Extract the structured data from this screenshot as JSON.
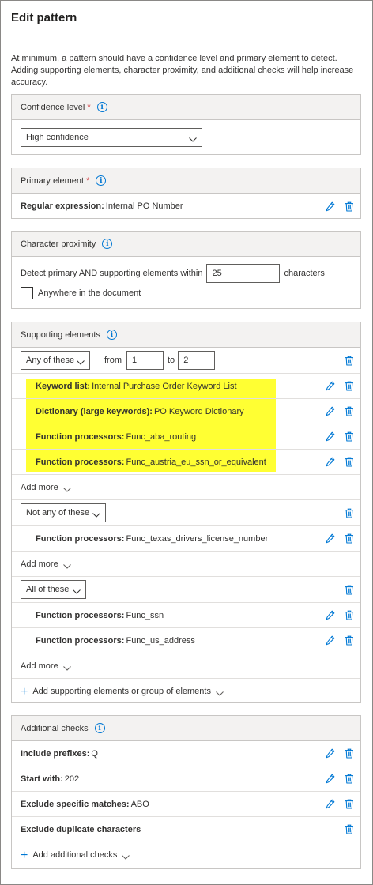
{
  "title": "Edit pattern",
  "intro": "At minimum, a pattern should have a confidence level and primary element to detect. Adding supporting elements, character proximity, and additional checks will help increase accuracy.",
  "confidence": {
    "heading": "Confidence level",
    "required": "*",
    "info": "i",
    "selected": "High confidence"
  },
  "primary": {
    "heading": "Primary element",
    "required": "*",
    "info": "i",
    "label": "Regular expression:",
    "value": "Internal PO Number"
  },
  "proximity": {
    "heading": "Character proximity",
    "info": "i",
    "prefix": "Detect primary AND supporting elements within",
    "value": "25",
    "suffix": "characters",
    "anywhere_label": "Anywhere in the document"
  },
  "supporting": {
    "heading": "Supporting elements",
    "info": "i",
    "group1": {
      "selector": "Any of these",
      "from_label": "from",
      "from_value": "1",
      "to_label": "to",
      "to_value": "2",
      "items": [
        {
          "label": "Keyword list:",
          "value": "Internal Purchase Order Keyword List"
        },
        {
          "label": "Dictionary (large keywords):",
          "value": "PO Keyword Dictionary"
        },
        {
          "label": "Function processors:",
          "value": "Func_aba_routing"
        },
        {
          "label": "Function processors:",
          "value": "Func_austria_eu_ssn_or_equivalent"
        }
      ],
      "add_more": "Add more"
    },
    "group2": {
      "selector": "Not any of these",
      "items": [
        {
          "label": "Function processors:",
          "value": "Func_texas_drivers_license_number"
        }
      ],
      "add_more": "Add more"
    },
    "group3": {
      "selector": "All of these",
      "items": [
        {
          "label": "Function processors:",
          "value": "Func_ssn"
        },
        {
          "label": "Function processors:",
          "value": "Func_us_address"
        }
      ],
      "add_more": "Add more"
    },
    "add_group": "Add supporting elements or group of elements"
  },
  "checks": {
    "heading": "Additional checks",
    "info": "i",
    "items": [
      {
        "label": "Include prefixes:",
        "value": "Q"
      },
      {
        "label": "Start with:",
        "value": "202"
      },
      {
        "label": "Exclude specific matches:",
        "value": "ABO"
      },
      {
        "label": "Exclude duplicate characters",
        "value": ""
      }
    ],
    "add_checks": "Add additional checks"
  },
  "colors": {
    "accent": "#0078d4",
    "highlight": "#ffff33",
    "required": "#d13438",
    "header_bg": "#f3f2f1"
  }
}
